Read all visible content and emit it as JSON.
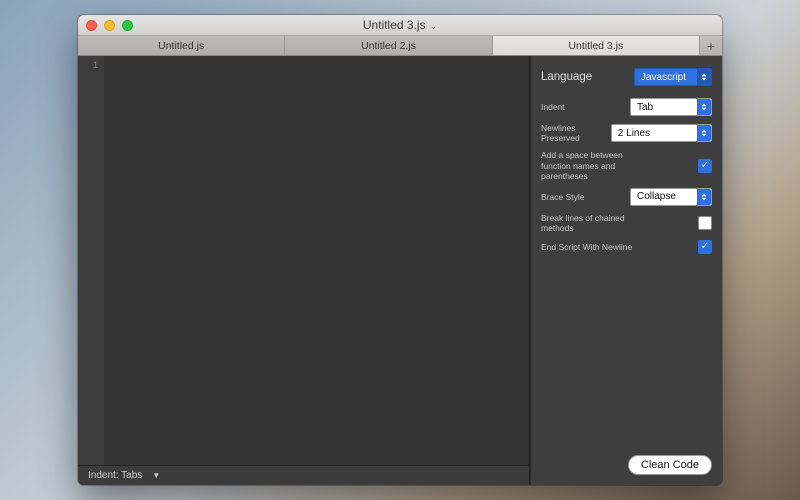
{
  "window": {
    "title": "Untitled 3.js"
  },
  "tabs": [
    {
      "label": "Untitled.js"
    },
    {
      "label": "Untitled 2.js"
    },
    {
      "label": "Untitled 3.js"
    }
  ],
  "active_tab_index": 2,
  "add_tab_glyph": "+",
  "editor": {
    "line_number": "1"
  },
  "statusbar": {
    "indent": "Indent: Tabs",
    "chevron": "▼"
  },
  "sidebar": {
    "language_label": "Language",
    "language_value": "Javascript",
    "rows": {
      "indent_label": "Indent",
      "indent_value": "Tab",
      "newlines_label": "Newlines Preserved",
      "newlines_value": "2 Lines",
      "space_fn_label": "Add a space between function names and parentheses",
      "space_fn_checked": true,
      "brace_label": "Brace Style",
      "brace_value": "Collapse",
      "chain_label": "Break lines of chained methods",
      "chain_checked": false,
      "newline_end_label": "End Script With Newline",
      "newline_end_checked": true
    },
    "clean_button": "Clean Code"
  }
}
